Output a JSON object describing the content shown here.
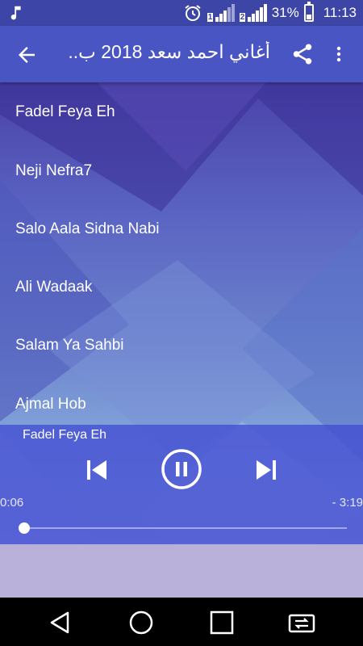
{
  "status_bar": {
    "battery": "31%",
    "time": "11:13",
    "battery_level": 0.31,
    "icons": [
      "music-note-icon",
      "alarm-icon",
      "sim1-signal-icon",
      "sim2-signal-icon",
      "battery-icon"
    ]
  },
  "app_bar": {
    "title": "أغاني احمد سعد 2018 ب..",
    "back_icon": "arrow-back-icon",
    "share_icon": "share-icon",
    "menu_icon": "more-vert-icon"
  },
  "songs": [
    "Fadel Feya Eh",
    "Neji Nefra7",
    "Salo Aala Sidna Nabi",
    "Ali Wadaak",
    "Salam Ya Sahbi",
    "Ajmal Hob"
  ],
  "player": {
    "now_playing": "Fadel Feya Eh",
    "elapsed": "0:06",
    "remaining": "- 3:19",
    "state": "playing",
    "progress": 0.03
  },
  "nav_bar": {
    "icons": [
      "back-triangle-icon",
      "home-circle-icon",
      "recents-square-icon",
      "switch-sim-icon"
    ]
  },
  "colors": {
    "app_bar": "#4a55c4",
    "status_bar": "#3d46a6",
    "player": "#4a50d2"
  }
}
